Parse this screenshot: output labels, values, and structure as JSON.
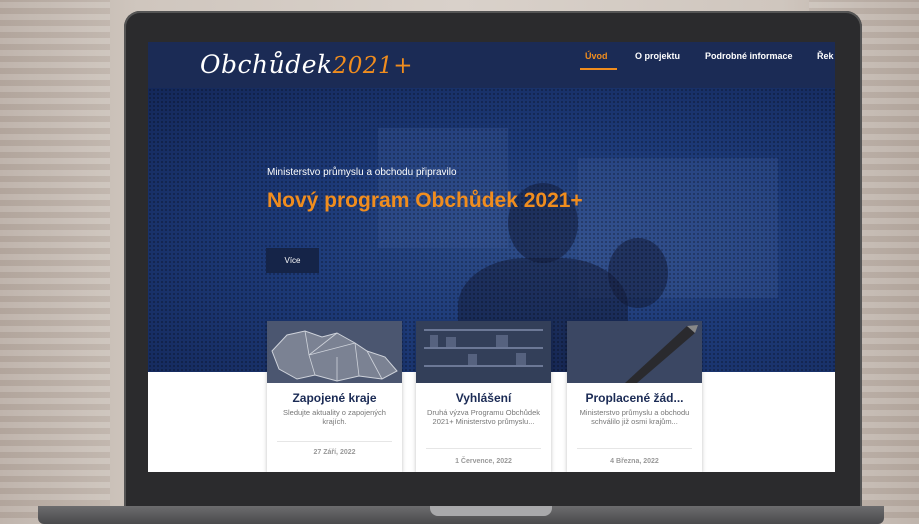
{
  "site": {
    "logo_main": "Obchůdek",
    "logo_suffix": "2021+"
  },
  "nav": {
    "items": [
      {
        "label": "Úvod",
        "active": true
      },
      {
        "label": "O projektu",
        "active": false
      },
      {
        "label": "Podrobné informace",
        "active": false
      },
      {
        "label": "Řek",
        "active": false
      }
    ]
  },
  "hero": {
    "subtitle": "Ministerstvo průmyslu a obchodu připravilo",
    "title": "Nový program Obchůdek 2021+",
    "button_label": "Více"
  },
  "cards": [
    {
      "title": "Zapojené kraje",
      "description": "Sledujte aktuality o zapojených krajích.",
      "date": "27 Září, 2022",
      "image_icon": "czech-map-icon"
    },
    {
      "title": "Vyhlášení",
      "description": "Druhá výzva Programu Obchůdek 2021+ Ministerstvo průmyslu...",
      "date": "1 Července, 2022",
      "image_icon": "shop-shelves-icon"
    },
    {
      "title": "Proplacené žád...",
      "description": "Ministerstvo průmyslu a obchodu schválilo již osmi krajům...",
      "date": "4 Března, 2022",
      "image_icon": "pen-icon"
    }
  ],
  "colors": {
    "navy": "#1b2b55",
    "accent_orange": "#f08d1e"
  }
}
